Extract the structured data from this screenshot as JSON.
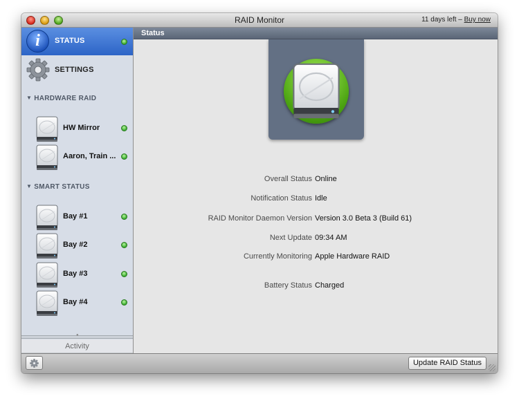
{
  "window": {
    "title": "RAID Monitor",
    "trial_text": "11 days left –",
    "buy_label": "Buy now"
  },
  "sidebar": {
    "status_label": "STATUS",
    "settings_label": "SETTINGS",
    "hardware_raid_header": "HARDWARE RAID",
    "hardware_items": [
      {
        "label": "HW Mirror"
      },
      {
        "label": "Aaron, Train ..."
      }
    ],
    "smart_status_header": "SMART STATUS",
    "smart_items": [
      {
        "label": "Bay #1"
      },
      {
        "label": "Bay #2"
      },
      {
        "label": "Bay #3"
      },
      {
        "label": "Bay #4"
      }
    ],
    "activity_label": "Activity"
  },
  "main": {
    "header": "Status",
    "rows": [
      {
        "key": "Overall Status",
        "value": "Online"
      },
      {
        "key": "Notification Status",
        "value": "Idle"
      },
      {
        "key": "RAID Monitor Daemon Version",
        "value": "Version 3.0 Beta 3 (Build 61)"
      },
      {
        "key": "Next Update",
        "value": "09:34 AM"
      },
      {
        "key": "Currently Monitoring",
        "value": "Apple Hardware RAID"
      },
      {
        "key": "Battery Status",
        "value": "Charged"
      }
    ]
  },
  "bottombar": {
    "update_label": "Update RAID Status"
  },
  "icons": {
    "status": "info-icon",
    "settings": "gear-icon",
    "disk": "hard-disk-icon",
    "indicator": "green-status-indicator"
  },
  "colors": {
    "selection": "#2c64c7",
    "status_ok": "#36a92c",
    "hero_bg": "#637084"
  }
}
